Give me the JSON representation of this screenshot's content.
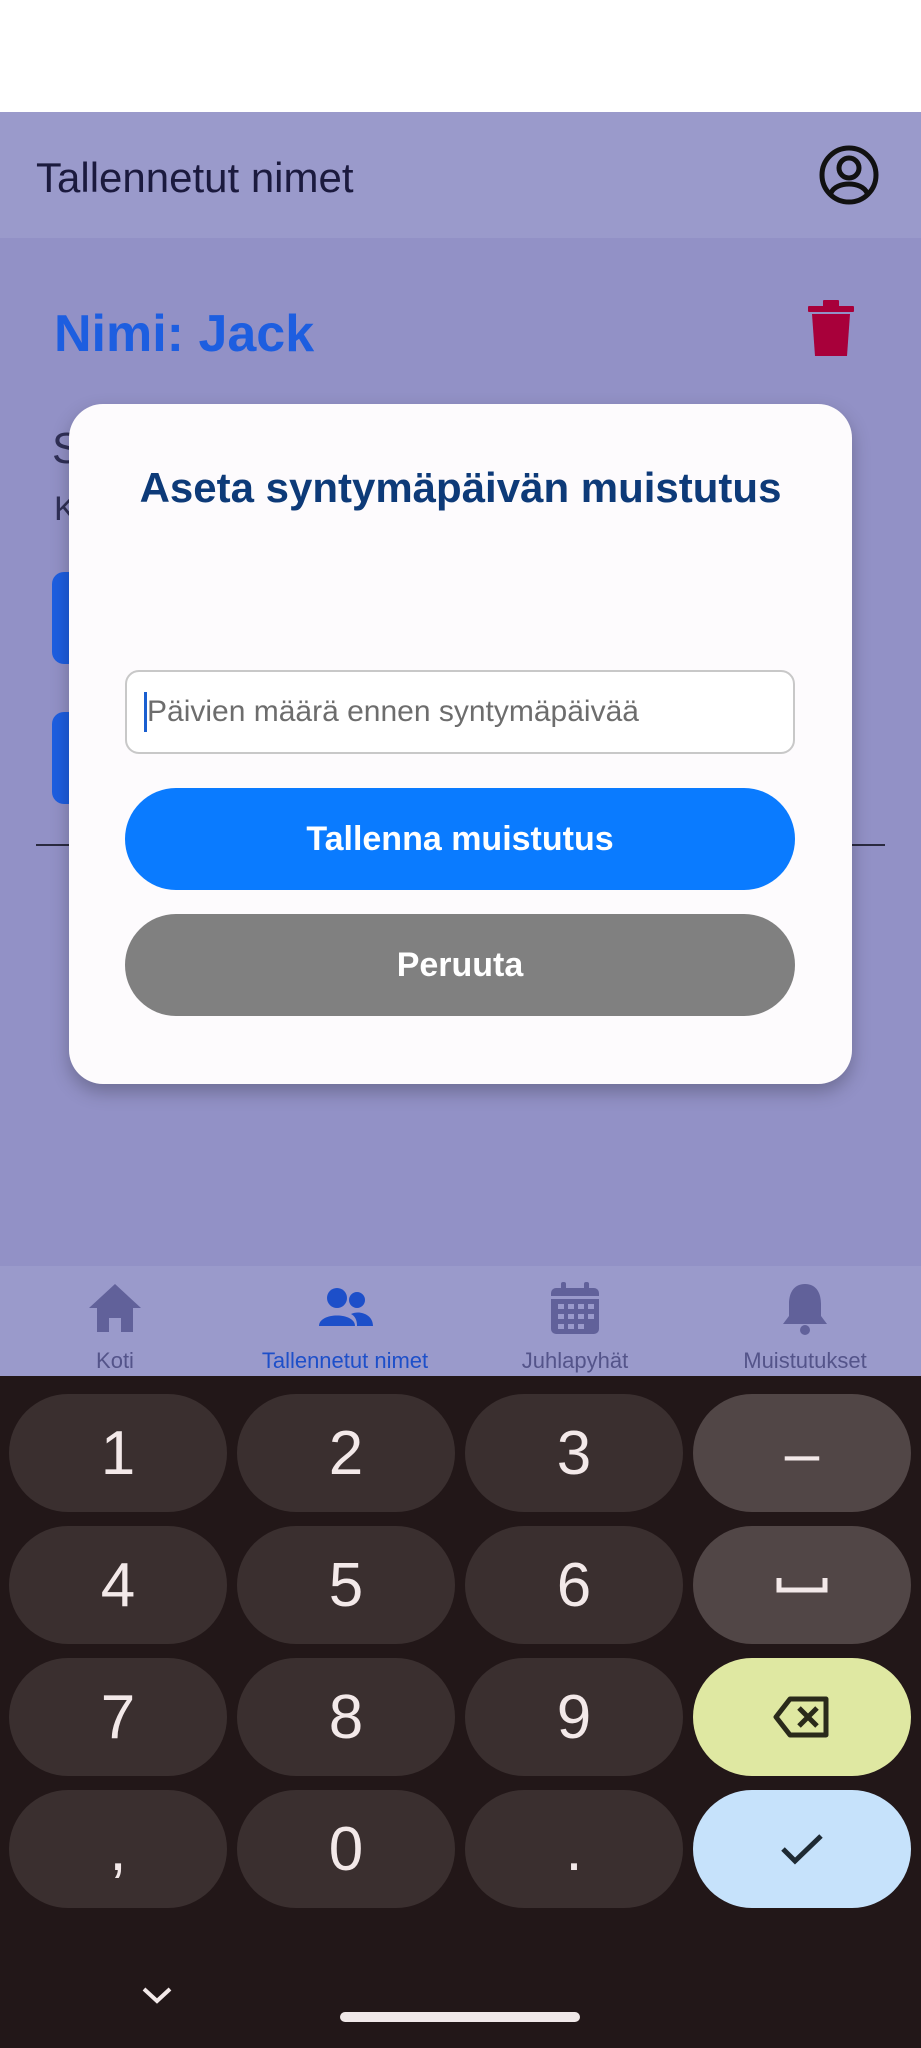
{
  "app_bar": {
    "title": "Tallennetut nimet",
    "profile_icon": "account-circle-icon"
  },
  "content": {
    "name_title": "Nimi: Jack",
    "delete_icon": "trash-icon",
    "partial_text_1": "S",
    "partial_text_2": "K"
  },
  "dialog": {
    "title": "Aseta syntymäpäivän muistutus",
    "input_placeholder": "Päivien määrä ennen syntymäpäivää",
    "input_value": "",
    "save_label": "Tallenna muistutus",
    "cancel_label": "Peruuta"
  },
  "bottom_nav": {
    "items": [
      {
        "label": "Koti",
        "icon": "home-icon",
        "active": false
      },
      {
        "label": "Tallennetut nimet",
        "icon": "people-icon",
        "active": true
      },
      {
        "label": "Juhlapyhät",
        "icon": "calendar-icon",
        "active": false
      },
      {
        "label": "Muistutukset",
        "icon": "bell-icon",
        "active": false
      }
    ]
  },
  "keyboard": {
    "keys": {
      "k1": "1",
      "k2": "2",
      "k3": "3",
      "minus": "–",
      "k4": "4",
      "k5": "5",
      "k6": "6",
      "k7": "7",
      "k8": "8",
      "k9": "9",
      "comma": ",",
      "k0": "0",
      "period": "."
    },
    "special_icons": [
      "space-icon",
      "backspace-icon",
      "checkmark-icon",
      "chevron-down-icon"
    ]
  },
  "colors": {
    "app_bar_bg": "#9a9acb",
    "content_bg": "#9291c6",
    "accent_blue": "#0a7bff",
    "title_blue": "#1d5ee0",
    "delete_red": "#a8003a",
    "cancel_gray": "#808080"
  }
}
